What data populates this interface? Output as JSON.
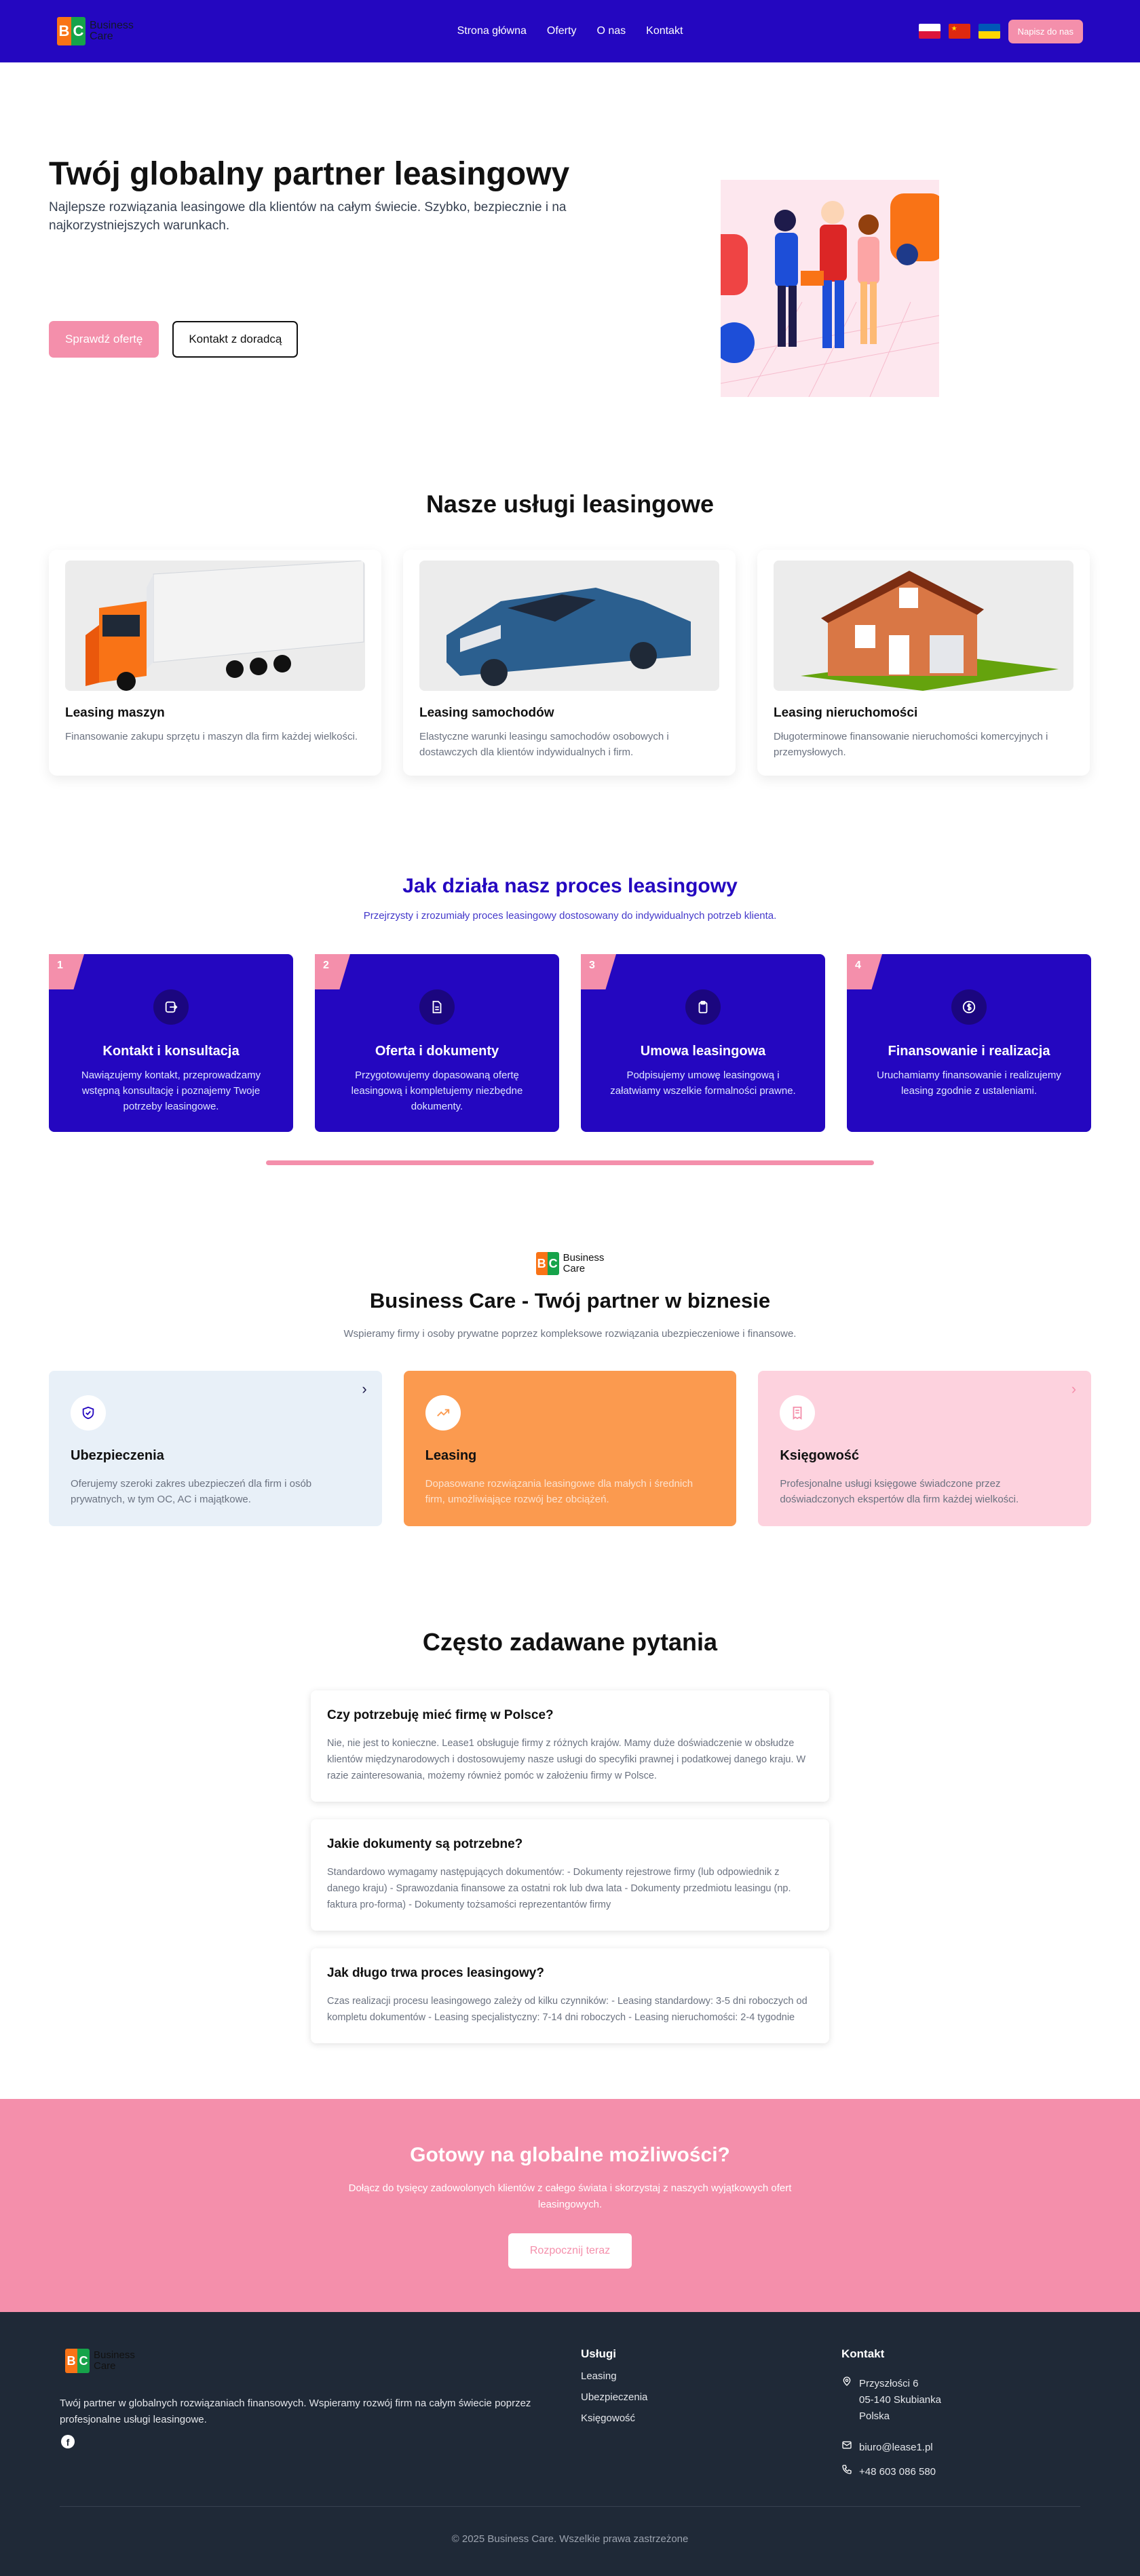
{
  "brand": {
    "mark_left": "B",
    "mark_right": "C",
    "line1": "Business",
    "line2": "Care"
  },
  "nav": {
    "links": [
      "Strona główna",
      "Oferty",
      "O nas",
      "Kontakt"
    ],
    "flags": [
      "pl-flag-icon",
      "cn-flag-icon",
      "ua-flag-icon"
    ],
    "cta": "Napisz do nas"
  },
  "hero": {
    "title": "Twój globalny partner leasingowy",
    "subtitle": "Najlepsze rozwiązania leasingowe dla klientów na całym świecie. Szybko, bezpiecznie i na najkorzystniejszych warunkach.",
    "primary_btn": "Sprawdź ofertę",
    "secondary_btn": "Kontakt z doradcą"
  },
  "services": {
    "title": "Nasze usługi leasingowe",
    "items": [
      {
        "title": "Leasing maszyn",
        "desc": "Finansowanie zakupu sprzętu i maszyn dla firm każdej wielkości."
      },
      {
        "title": "Leasing samochodów",
        "desc": "Elastyczne warunki leasingu samochodów osobowych i dostawczych dla klientów indywidualnych i firm."
      },
      {
        "title": "Leasing nieruchomości",
        "desc": "Długoterminowe finansowanie nieruchomości komercyjnych i przemysłowych."
      }
    ]
  },
  "process": {
    "title": "Jak działa nasz proces leasingowy",
    "subtitle": "Przejrzysty i zrozumiały proces leasingowy dostosowany do indywidualnych potrzeb klienta.",
    "steps": [
      {
        "num": "1",
        "title": "Kontakt i konsultacja",
        "desc": "Nawiązujemy kontakt, przeprowadzamy wstępną konsultację i poznajemy Twoje potrzeby leasingowe.",
        "icon": "login-icon"
      },
      {
        "num": "2",
        "title": "Oferta i dokumenty",
        "desc": "Przygotowujemy dopasowaną ofertę leasingową i kompletujemy niezbędne dokumenty.",
        "icon": "document-icon"
      },
      {
        "num": "3",
        "title": "Umowa leasingowa",
        "desc": "Podpisujemy umowę leasingową i załatwiamy wszelkie formalności prawne.",
        "icon": "clipboard-icon"
      },
      {
        "num": "4",
        "title": "Finansowanie i realizacja",
        "desc": "Uruchamiamy finansowanie i realizujemy leasing zgodnie z ustaleniami.",
        "icon": "dollar-icon"
      }
    ]
  },
  "partner": {
    "title": "Business Care - Twój partner w biznesie",
    "subtitle": "Wspieramy firmy i osoby prywatne poprzez kompleksowe rozwiązania ubezpieczeniowe i finansowe.",
    "cards": [
      {
        "title": "Ubezpieczenia",
        "desc": "Oferujemy szeroki zakres ubezpieczeń dla firm i osób prywatnych, w tym OC, AC i majątkowe.",
        "icon": "shield-check-icon",
        "arrow": "›"
      },
      {
        "title": "Leasing",
        "desc": "Dopasowane rozwiązania leasingowe dla małych i średnich firm, umożliwiające rozwój bez obciążeń.",
        "icon": "trend-up-icon",
        "arrow": ""
      },
      {
        "title": "Księgowość",
        "desc": "Profesjonalne usługi księgowe świadczone przez doświadczonych ekspertów dla firm każdej wielkości.",
        "icon": "receipt-icon",
        "arrow": "›"
      }
    ]
  },
  "faq": {
    "title": "Często zadawane pytania",
    "items": [
      {
        "q": "Czy potrzebuję mieć firmę w Polsce?",
        "a": "Nie, nie jest to konieczne. Lease1 obsługuje firmy z różnych krajów. Mamy duże doświadczenie w obsłudze klientów międzynarodowych i dostosowujemy nasze usługi do specyfiki prawnej i podatkowej danego kraju. W razie zainteresowania, możemy również pomóc w założeniu firmy w Polsce."
      },
      {
        "q": "Jakie dokumenty są potrzebne?",
        "a": "Standardowo wymagamy następujących dokumentów: - Dokumenty rejestrowe firmy (lub odpowiednik z danego kraju) - Sprawozdania finansowe za ostatni rok lub dwa lata - Dokumenty przedmiotu leasingu (np. faktura pro-forma) - Dokumenty tożsamości reprezentantów firmy"
      },
      {
        "q": "Jak długo trwa proces leasingowy?",
        "a": "Czas realizacji procesu leasingowego zależy od kilku czynników: - Leasing standardowy: 3-5 dni roboczych od kompletu dokumentów - Leasing specjalistyczny: 7-14 dni roboczych - Leasing nieruchomości: 2-4 tygodnie"
      }
    ]
  },
  "cta": {
    "title": "Gotowy na globalne możliwości?",
    "text": "Dołącz do tysięcy zadowolonych klientów z całego świata i skorzystaj z naszych wyjątkowych ofert leasingowych.",
    "button": "Rozpocznij teraz"
  },
  "footer": {
    "desc": "Twój partner w globalnych rozwiązaniach finansowych. Wspieramy rozwój firm na całym świecie poprzez profesjonalne usługi leasingowe.",
    "social_icon": "facebook-icon",
    "services_title": "Usługi",
    "services": [
      "Leasing",
      "Ubezpieczenia",
      "Księgowość"
    ],
    "contact_title": "Kontakt",
    "address": [
      "Przyszłości 6",
      "05-140 Skubianka",
      "Polska"
    ],
    "email": "biuro@lease1.pl",
    "phone": "+48 603 086 580",
    "copyright": "© 2025 Business Care. Wszelkie prawa zastrzeżone"
  },
  "colors": {
    "primary": "#2407c0",
    "accent": "#f48fab",
    "orange": "#fb9a4f",
    "footer": "#1f2937"
  }
}
